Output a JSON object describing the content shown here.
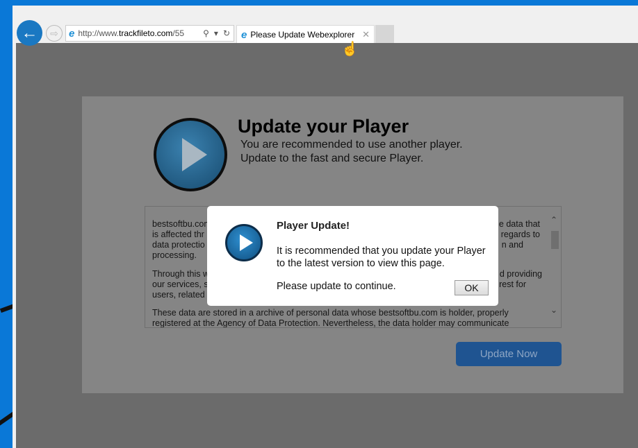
{
  "browser": {
    "address_prefix": "http://www.",
    "address_domain": "trackfileto.com",
    "address_suffix": "/55",
    "tab_title": "Please Update Webexplorer",
    "icons": [
      "back-arrow-icon",
      "forward-arrow-icon",
      "ie-logo-icon",
      "search-icon",
      "dropdown-icon",
      "refresh-icon",
      "close-tab-icon",
      "hand-cursor-icon"
    ]
  },
  "page": {
    "title": "Update your Player",
    "subtitle_1": "You are recommended to use another player.",
    "subtitle_2": "Update to the fast and secure Player.",
    "terms_lines_left": [
      "bestsoftbu.com",
      "is affected thr",
      "data protectio",
      "processing.",
      "Through this w",
      "our services, s",
      "users, related"
    ],
    "terms_lines_right": [
      "e data that",
      "regards to",
      "n and",
      "d providing",
      "rest for"
    ],
    "terms_full_lines": [
      "These data are stored in a archive of personal data whose bestsoftbu.com is holder, properly",
      "registered at the Agency of Data Protection. Nevertheless, the data holder may communicate"
    ],
    "update_button": "Update Now",
    "button_color": "#1f5491"
  },
  "dialog": {
    "title": "Player Update!",
    "message": "It is recommended that you update your Player to the latest version to view this page.",
    "continue_text": "Please update to continue.",
    "ok_label": "OK"
  }
}
